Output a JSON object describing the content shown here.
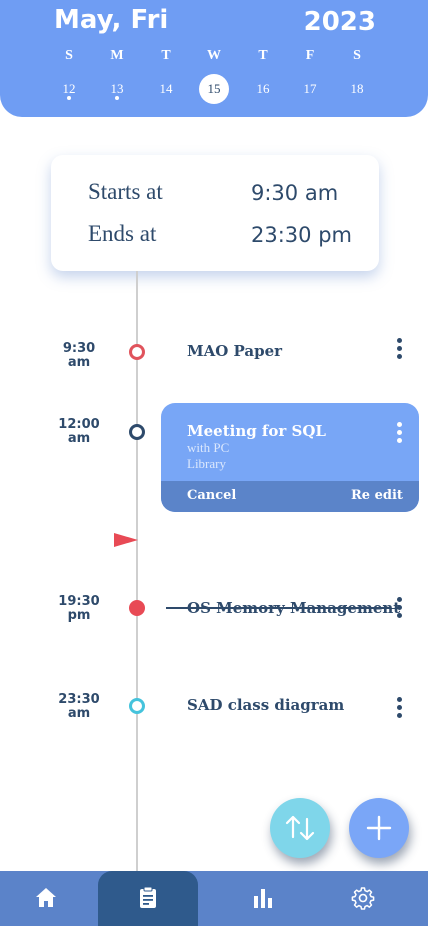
{
  "header": {
    "month_day": "May, Fri",
    "year": "2023",
    "week": [
      {
        "dow": "S",
        "date": "12",
        "has_event": true,
        "selected": false
      },
      {
        "dow": "M",
        "date": "13",
        "has_event": true,
        "selected": false
      },
      {
        "dow": "T",
        "date": "14",
        "has_event": false,
        "selected": false
      },
      {
        "dow": "W",
        "date": "15",
        "has_event": false,
        "selected": true
      },
      {
        "dow": "T",
        "date": "16",
        "has_event": false,
        "selected": false
      },
      {
        "dow": "F",
        "date": "17",
        "has_event": false,
        "selected": false
      },
      {
        "dow": "S",
        "date": "18",
        "has_event": false,
        "selected": false
      }
    ]
  },
  "time_card": {
    "starts_label": "Starts at",
    "starts_value": "9:30 am",
    "ends_label": "Ends at",
    "ends_value": "23:30 pm"
  },
  "timeline": [
    {
      "time": "9:30",
      "period": "am",
      "title": "MAO Paper",
      "node_color": "#e0535c",
      "filled": false,
      "completed": false
    },
    {
      "time": "12:00",
      "period": "am",
      "title": "Meeting for SQL",
      "node_color": "#2e4a6b",
      "filled": false,
      "completed": false
    },
    {
      "time": "19:30",
      "period": "pm",
      "title": "OS Memory Management",
      "node_color": "#e84a55",
      "filled": true,
      "completed": true
    },
    {
      "time": "23:30",
      "period": "am",
      "title": "SAD class diagram",
      "node_color": "#45c3dc",
      "filled": false,
      "completed": false
    }
  ],
  "expanded_event": {
    "title": "Meeting for SQL",
    "with": "with PC",
    "location": "Library",
    "cancel_label": "Cancel",
    "reedit_label": "Re edit"
  },
  "fabs": {
    "sort_icon": "sort-icon",
    "add_icon": "plus-icon",
    "sort_color": "#7fd6ea",
    "add_color": "#7aa6f7"
  },
  "nav": {
    "items": [
      "home-icon",
      "clipboard-icon",
      "bar-chart-icon",
      "gear-icon"
    ],
    "active": "clipboard-icon"
  },
  "colors": {
    "header_bg": "#6f9df3",
    "accent_dark": "#2e4a6b",
    "nav_bg": "#5b83c9",
    "nav_active": "#2f5a8c",
    "now_flag": "#e84a55"
  }
}
